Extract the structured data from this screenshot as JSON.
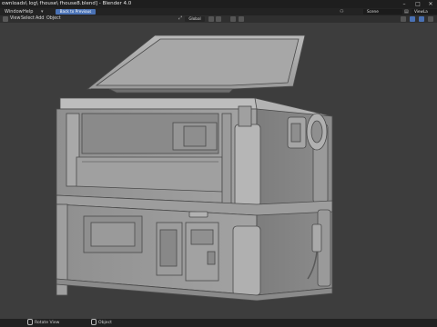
{
  "window": {
    "title": "ownloads\\ log\\ fhouse\\ fhouse8.blend] - Blender 4.0",
    "controls": [
      "–",
      "□",
      "✕"
    ]
  },
  "topbar": {
    "menus": [
      "Window",
      "Help"
    ],
    "back_button": "Back to Previous",
    "scene_label": "Scene",
    "view_layer_label": "ViewLa"
  },
  "viewport_header": {
    "menus": [
      "View",
      "Select",
      "Add",
      "Object"
    ],
    "orientation": "Global",
    "mode_icon": "object-mode-icon"
  },
  "statusbar": {
    "rotate_view": "Rotate View",
    "object": "Object"
  },
  "colors": {
    "model_gray": "#9a9a9a",
    "model_dark": "#6e6e6e",
    "accent_blue": "#4a72b5",
    "viewport_bg": "#3d3d3d"
  }
}
